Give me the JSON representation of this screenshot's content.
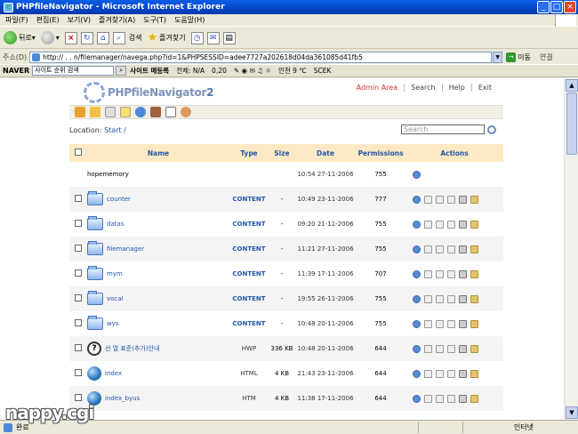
{
  "window": {
    "title": "PHPfileNavigator - Microsoft Internet Explorer"
  },
  "menu": [
    "파일(F)",
    "편집(E)",
    "보기(V)",
    "즐겨찾기(A)",
    "도구(T)",
    "도움말(H)"
  ],
  "toolbar": {
    "back": "뒤로",
    "search": "검색",
    "favorites": "즐겨찾기"
  },
  "address": {
    "label": "주소(D)",
    "url": "http://   .   .      n/filemanager/navega.php?id=1&PHPSESSID=adee7727a202618d04da361085d41fb5",
    "go": "이동",
    "links": "연결"
  },
  "naver": {
    "logo": "NAVER",
    "search_value": "사이트 순위 검색",
    "site": "사이트 매등록",
    "total": "전체: N/A",
    "score": "0,20",
    "weather": "인천 9 ℃",
    "stock": "SCEK"
  },
  "app": {
    "logo": "PHPfileNavigator",
    "logo_suffix": "2",
    "nav": {
      "admin": "Admin Area",
      "search": "Search",
      "help": "Help",
      "exit": "Exit"
    },
    "location_label": "Location:",
    "location_path": "Start /",
    "search_placeholder": "Search",
    "columns": {
      "name": "Name",
      "type": "Type",
      "size": "Size",
      "date": "Date",
      "permissions": "Permissions",
      "actions": "Actions"
    },
    "rows": [
      {
        "name": "hopememory",
        "type": "",
        "size": "",
        "date": "10:54 27-11-2006",
        "perm": "755",
        "kind": "root"
      },
      {
        "name": "counter",
        "type": "CONTENT",
        "size": "-",
        "date": "10:49 23-11-2006",
        "perm": "777",
        "kind": "folder"
      },
      {
        "name": "datas",
        "type": "CONTENT",
        "size": "-",
        "date": "09:20 21-11-2006",
        "perm": "755",
        "kind": "folder"
      },
      {
        "name": "filemanager",
        "type": "CONTENT",
        "size": "-",
        "date": "11:21 27-11-2006",
        "perm": "755",
        "kind": "folder"
      },
      {
        "name": "mym",
        "type": "CONTENT",
        "size": "-",
        "date": "11:39 17-11-2006",
        "perm": "707",
        "kind": "folder"
      },
      {
        "name": "vocal",
        "type": "CONTENT",
        "size": "-",
        "date": "19:55 26-11-2006",
        "perm": "755",
        "kind": "folder"
      },
      {
        "name": "wys",
        "type": "CONTENT",
        "size": "-",
        "date": "10:48 20-11-2006",
        "perm": "755",
        "kind": "folder"
      },
      {
        "name": "선               열           표준(추가)안내",
        "type": "HWP",
        "size": "336 KB",
        "date": "10:48 20-11-2006",
        "perm": "644",
        "kind": "help"
      },
      {
        "name": "index",
        "type": "HTML",
        "size": "4 KB",
        "date": "21:43 23-11-2006",
        "perm": "644",
        "kind": "globe"
      },
      {
        "name": "index_byus",
        "type": "HTM",
        "size": "4 KB",
        "date": "11:38 17-11-2006",
        "perm": "644",
        "kind": "globe"
      }
    ]
  },
  "status": {
    "done": "완료",
    "zone": "인터넷"
  },
  "watermark": "nappy.cgi"
}
